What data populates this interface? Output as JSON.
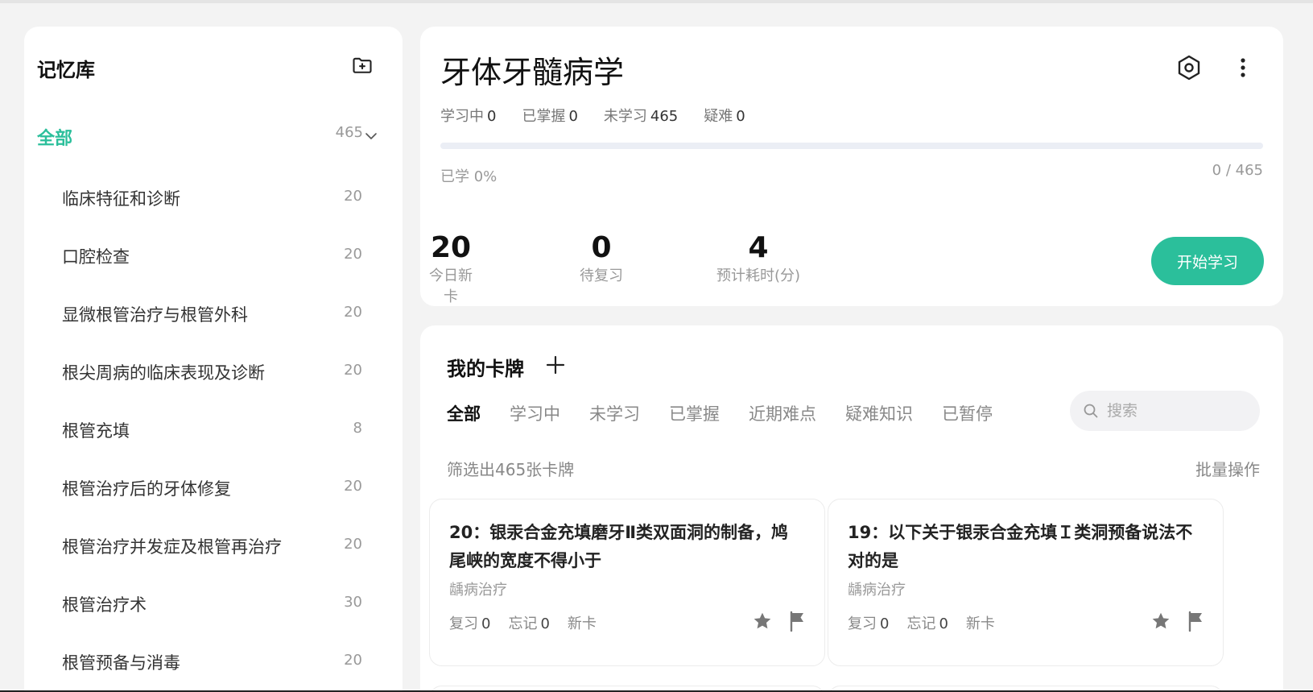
{
  "sidebar": {
    "title": "记忆库",
    "all_label": "全部",
    "all_count": "465",
    "items": [
      {
        "label": "临床特征和诊断",
        "count": "20"
      },
      {
        "label": "口腔检查",
        "count": "20"
      },
      {
        "label": "显微根管治疗与根管外科",
        "count": "20"
      },
      {
        "label": "根尖周病的临床表现及诊断",
        "count": "20"
      },
      {
        "label": "根管充填",
        "count": "8"
      },
      {
        "label": "根管治疗后的牙体修复",
        "count": "20"
      },
      {
        "label": "根管治疗并发症及根管再治疗",
        "count": "20"
      },
      {
        "label": "根管治疗术",
        "count": "30"
      },
      {
        "label": "根管预备与消毒",
        "count": "20"
      }
    ]
  },
  "header": {
    "deck_title": "牙体牙髓病学",
    "stats": [
      {
        "label": "学习中",
        "value": "0"
      },
      {
        "label": "已掌握",
        "value": "0"
      },
      {
        "label": "未学习",
        "value": "465"
      },
      {
        "label": "疑难",
        "value": "0"
      }
    ],
    "progress_fraction": 0,
    "learned_pct": "已学 0%",
    "learned_frac": "0 / 465",
    "metrics": [
      {
        "value": "20",
        "caption": "今日新卡"
      },
      {
        "value": "0",
        "caption": "待复习"
      },
      {
        "value": "4",
        "caption": "预计耗时(分)"
      }
    ],
    "start_label": "开始学习"
  },
  "cards_panel": {
    "title": "我的卡牌",
    "tabs": [
      "全部",
      "学习中",
      "未学习",
      "已掌握",
      "近期难点",
      "疑难知识",
      "已暂停"
    ],
    "active_tab": 0,
    "search_placeholder": "搜索",
    "filter_text": "筛选出465张卡牌",
    "batch_label": "批量操作",
    "cards": [
      {
        "question": "20：银汞合金充填磨牙Ⅱ类双面洞的制备，鸠尾峡的宽度不得小于",
        "category": "龋病治疗",
        "review_label": "复习",
        "review_value": "0",
        "forget_label": "忘记",
        "forget_value": "0",
        "status": "新卡"
      },
      {
        "question": "19：以下关于银汞合金充填Ｉ类洞预备说法不对的是",
        "category": "龋病治疗",
        "review_label": "复习",
        "review_value": "0",
        "forget_label": "忘记",
        "forget_value": "0",
        "status": "新卡"
      }
    ]
  },
  "colors": {
    "accent": "#2bbf9b",
    "icon_gray": "#777777"
  },
  "icons": {
    "add_folder": "folder-plus-icon",
    "chevron": "chevron-down-icon",
    "target": "target-icon",
    "more": "more-vertical-icon",
    "plus": "plus-icon",
    "search": "search-icon",
    "star": "star-icon",
    "flag": "flag-icon"
  }
}
